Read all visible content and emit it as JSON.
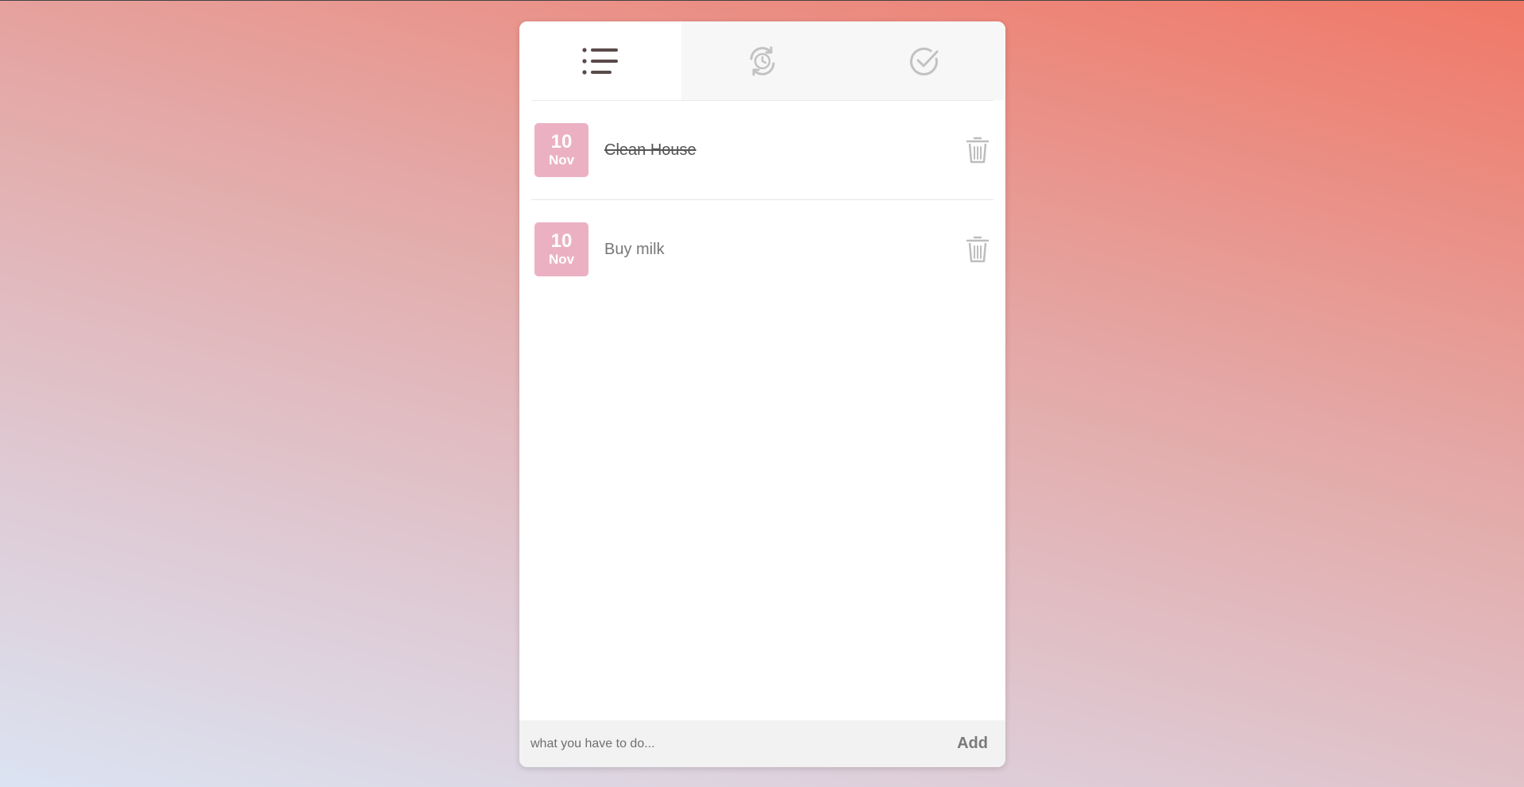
{
  "tabs": [
    {
      "icon": "list-icon",
      "active": true
    },
    {
      "icon": "sync-clock-icon",
      "active": false
    },
    {
      "icon": "check-circle-icon",
      "active": false
    }
  ],
  "todos": [
    {
      "day": "10",
      "month": "Nov",
      "text": "Clean House",
      "done": true
    },
    {
      "day": "10",
      "month": "Nov",
      "text": "Buy milk",
      "done": false
    }
  ],
  "input": {
    "placeholder": "what you have to do...",
    "value": ""
  },
  "add_label": "Add",
  "colors": {
    "date_badge": "#ebb1c3",
    "active_icon": "#5a4a4a",
    "inactive_icon": "#c2c2c2"
  }
}
